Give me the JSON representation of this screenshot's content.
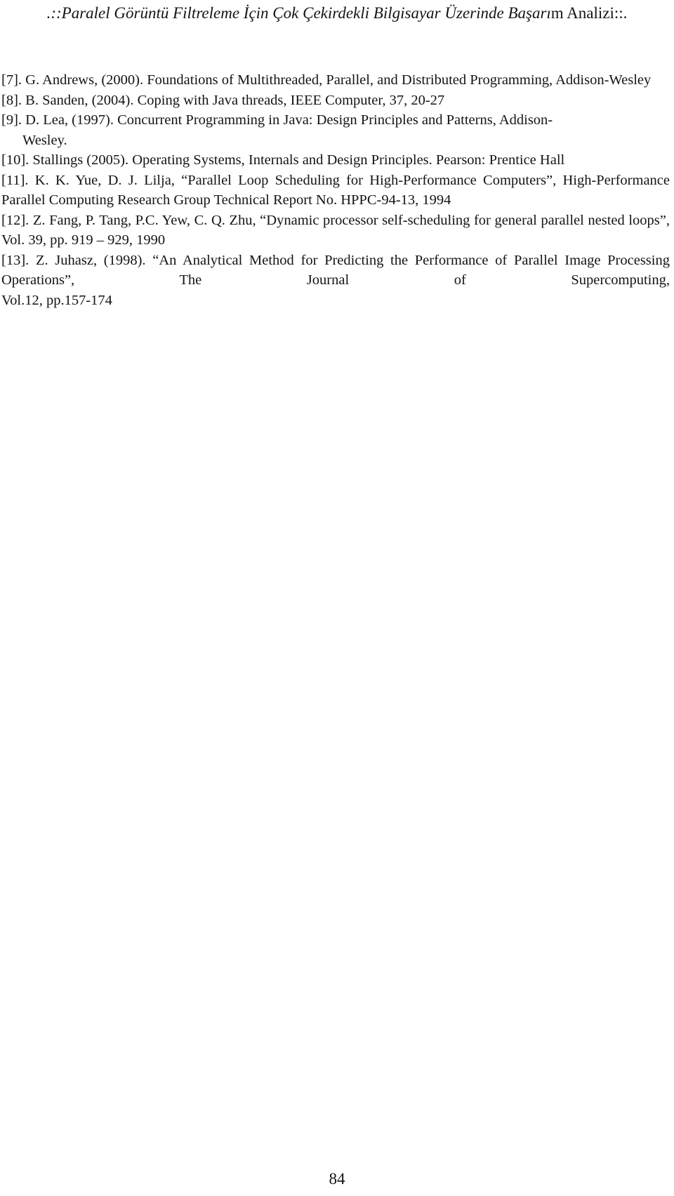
{
  "header": {
    "title_italic": ".::Paralel Görüntü Filtreleme İçin Çok Çekirdekli Bilgisayar Üzerinde Başarı",
    "title_upright": "m Analizi::."
  },
  "references": [
    {
      "label": "[7].",
      "text": " G. Andrews, (2000). Foundations of Multithreaded, Parallel, and Distributed Programming, Addison-Wesley"
    },
    {
      "label": "[8].",
      "text": " B. Sanden, (2004). Coping with Java threads, IEEE Computer, 37,  20-27"
    },
    {
      "label": "[9].",
      "text": " D. Lea, (1997). Concurrent Programming in Java: Design Principles and Patterns, Addison-",
      "continuation": "Wesley."
    },
    {
      "label": "[10].",
      "text": " Stallings (2005). Operating Systems, Internals and Design Principles. Pearson: Prentice Hall"
    },
    {
      "label": "[11].",
      "text": " K. K. Yue, D. J. Lilja, “Parallel Loop Scheduling for High-Performance Computers”, High-Performance Parallel Computing Research Group Technical Report No. HPPC-94-13, 1994"
    },
    {
      "label": "[12].",
      "text": " Z. Fang, P. Tang, P.C. Yew, C. Q. Zhu, “Dynamic processor self-scheduling for general parallel nested loops”, Vol. 39, pp. 919 – 929, 1990"
    },
    {
      "label": "[13].",
      "text": " Z. Juhasz, (1998). “An Analytical Method for Predicting the Performance of Parallel Image Processing Operations”, The Journal of Supercomputing,",
      "last_line": "Vol.12, pp.157-174"
    }
  ],
  "footer": {
    "page_number": "84"
  }
}
